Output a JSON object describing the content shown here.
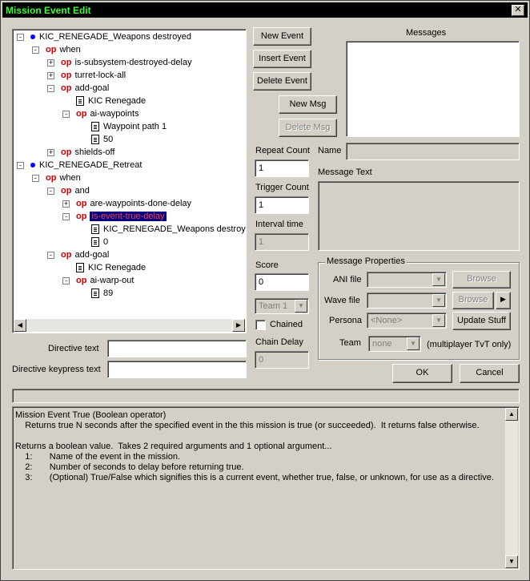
{
  "window": {
    "title": "Mission Event Edit",
    "close_glyph": "✕"
  },
  "tree": {
    "rows": [
      {
        "text": "KIC_RENEGADE_Weapons destroyed",
        "kind": "event"
      },
      {
        "text": "when",
        "kind": "op"
      },
      {
        "text": "is-subsystem-destroyed-delay",
        "kind": "op"
      },
      {
        "text": "turret-lock-all",
        "kind": "op"
      },
      {
        "text": "add-goal",
        "kind": "op"
      },
      {
        "text": "KIC Renegade",
        "kind": "doc"
      },
      {
        "text": "ai-waypoints",
        "kind": "op"
      },
      {
        "text": "Waypoint path 1",
        "kind": "doc"
      },
      {
        "text": "50",
        "kind": "doc"
      },
      {
        "text": "shields-off",
        "kind": "op"
      },
      {
        "text": "KIC_RENEGADE_Retreat",
        "kind": "event"
      },
      {
        "text": "when",
        "kind": "op"
      },
      {
        "text": "and",
        "kind": "op"
      },
      {
        "text": "are-waypoints-done-delay",
        "kind": "op"
      },
      {
        "text": "is-event-true-delay",
        "kind": "op",
        "selected": true
      },
      {
        "text": "KIC_RENEGADE_Weapons destroyed",
        "kind": "doc"
      },
      {
        "text": "0",
        "kind": "doc"
      },
      {
        "text": "add-goal",
        "kind": "op"
      },
      {
        "text": "KIC Renegade",
        "kind": "doc"
      },
      {
        "text": "ai-warp-out",
        "kind": "op"
      },
      {
        "text": "89",
        "kind": "doc"
      }
    ],
    "op_prefix": "op"
  },
  "buttons": {
    "new_event": "New Event",
    "insert_event": "Insert Event",
    "delete_event": "Delete Event",
    "new_msg": "New Msg",
    "delete_msg": "Delete Msg",
    "ok": "OK",
    "cancel": "Cancel",
    "browse1": "Browse",
    "browse2": "Browse",
    "update_stuff": "Update Stuff"
  },
  "messages_label": "Messages",
  "fields": {
    "repeat_count_label": "Repeat Count",
    "repeat_count": "1",
    "trigger_count_label": "Trigger Count",
    "trigger_count": "1",
    "interval_time_label": "Interval time",
    "interval_time": "1",
    "score_label": "Score",
    "score": "0",
    "team_select": "Team 1",
    "chained_label": "Chained",
    "chain_delay_label": "Chain Delay",
    "chain_delay": "0",
    "name_label": "Name",
    "message_text_label": "Message Text",
    "directive_text_label": "Directive text",
    "directive_keypress_label": "Directive keypress text"
  },
  "message_properties": {
    "title": "Message Properties",
    "ani_label": "ANI file",
    "wave_label": "Wave file",
    "persona_label": "Persona",
    "persona_value": "<None>",
    "team_label": "Team",
    "team_value": "none",
    "team_note": "(multiplayer TvT only)"
  },
  "help": {
    "lines": [
      "Mission Event True (Boolean operator)",
      "    Returns true N seconds after the specified event in the this mission is true (or succeeded).  It returns false otherwise.",
      "",
      "Returns a boolean value.  Takes 2 required arguments and 1 optional argument...",
      "    1:       Name of the event in the mission.",
      "    2:       Number of seconds to delay before returning true.",
      "    3:       (Optional) True/False which signifies this is a current event, whether true, false, or unknown, for use as a directive."
    ]
  }
}
